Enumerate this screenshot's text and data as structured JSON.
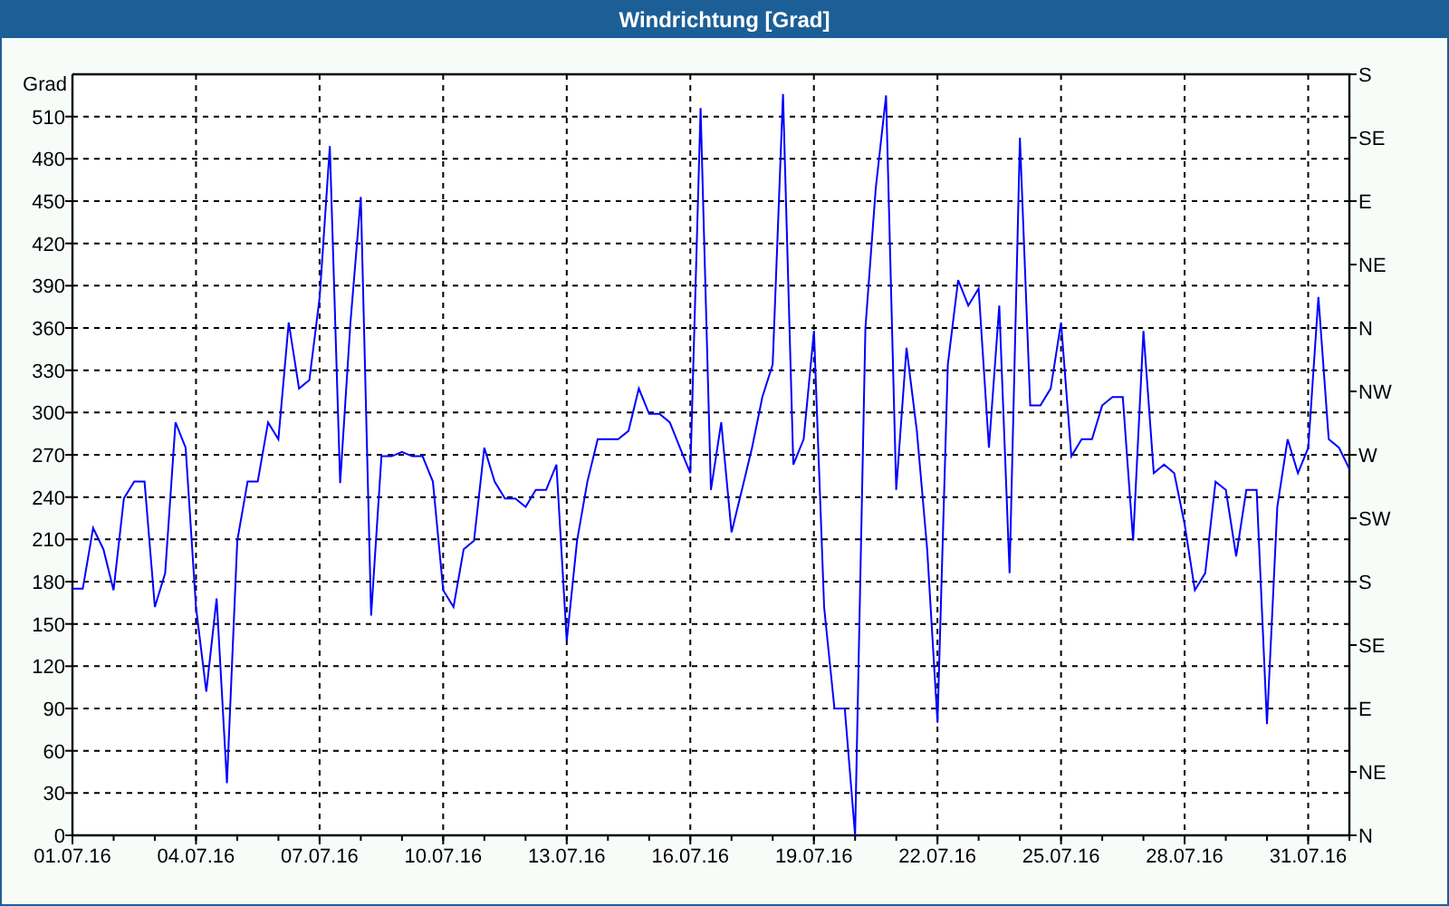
{
  "window": {
    "title": "Windrichtung [Grad]"
  },
  "chart": {
    "chart_data": {
      "type": "line",
      "grid": true,
      "ylabel": "Grad",
      "ylim": [
        0,
        540
      ],
      "categories": [
        "01.07.16",
        null,
        null,
        null,
        null,
        null,
        null,
        null,
        null,
        null,
        null,
        null,
        "04.07.16",
        null,
        null,
        null,
        null,
        null,
        null,
        null,
        null,
        null,
        null,
        null,
        "07.07.16",
        null,
        null,
        null,
        null,
        null,
        null,
        null,
        null,
        null,
        null,
        null,
        "10.07.16",
        null,
        null,
        null,
        null,
        null,
        null,
        null,
        null,
        null,
        null,
        null,
        "13.07.16",
        null,
        null,
        null,
        null,
        null,
        null,
        null,
        null,
        null,
        null,
        null,
        "16.07.16",
        null,
        null,
        null,
        null,
        null,
        null,
        null,
        null,
        null,
        null,
        null,
        "19.07.16",
        null,
        null,
        null,
        null,
        null,
        null,
        null,
        null,
        null,
        null,
        null,
        "22.07.16",
        null,
        null,
        null,
        null,
        null,
        null,
        null,
        null,
        null,
        null,
        null,
        "25.07.16",
        null,
        null,
        null,
        null,
        null,
        null,
        null,
        null,
        null,
        null,
        null,
        "28.07.16",
        null,
        null,
        null,
        null,
        null,
        null,
        null,
        null,
        null,
        null,
        null,
        "31.07.16",
        null,
        null,
        null,
        null
      ],
      "yticks": [
        0,
        30,
        60,
        90,
        120,
        150,
        180,
        210,
        240,
        270,
        300,
        330,
        360,
        390,
        420,
        450,
        480,
        510
      ],
      "series": [
        {
          "color": "#0000ff",
          "values": [
            175,
            175,
            218,
            203,
            174,
            239,
            251,
            251,
            162,
            186,
            293,
            275,
            162,
            102,
            168,
            37,
            209,
            251,
            251,
            293,
            281,
            364,
            317,
            323,
            382,
            489,
            250,
            364,
            453,
            156,
            269,
            269,
            272,
            269,
            269,
            251,
            174,
            162,
            203,
            209,
            275,
            251,
            239,
            239,
            233,
            245,
            245,
            263,
            138,
            209,
            251,
            281,
            281,
            281,
            287,
            317,
            299,
            299,
            293,
            275,
            257,
            516,
            245,
            293,
            215,
            245,
            275,
            311,
            334,
            526,
            263,
            281,
            358,
            162,
            90,
            90,
            0,
            360,
            459,
            525,
            245,
            346,
            287,
            203,
            80,
            334,
            394,
            376,
            388,
            275,
            376,
            186,
            495,
            305,
            305,
            317,
            364,
            269,
            281,
            281,
            305,
            311,
            311,
            209,
            358,
            257,
            263,
            257,
            221,
            174,
            186,
            251,
            245,
            198,
            245,
            245,
            79,
            233,
            281,
            257,
            275,
            382,
            281,
            275,
            260
          ]
        }
      ]
    },
    "compass_labels": [
      "S",
      "SE",
      "E",
      "NE",
      "N",
      "NW",
      "W",
      "SW",
      "S",
      "SE",
      "E",
      "NE",
      "N"
    ]
  }
}
